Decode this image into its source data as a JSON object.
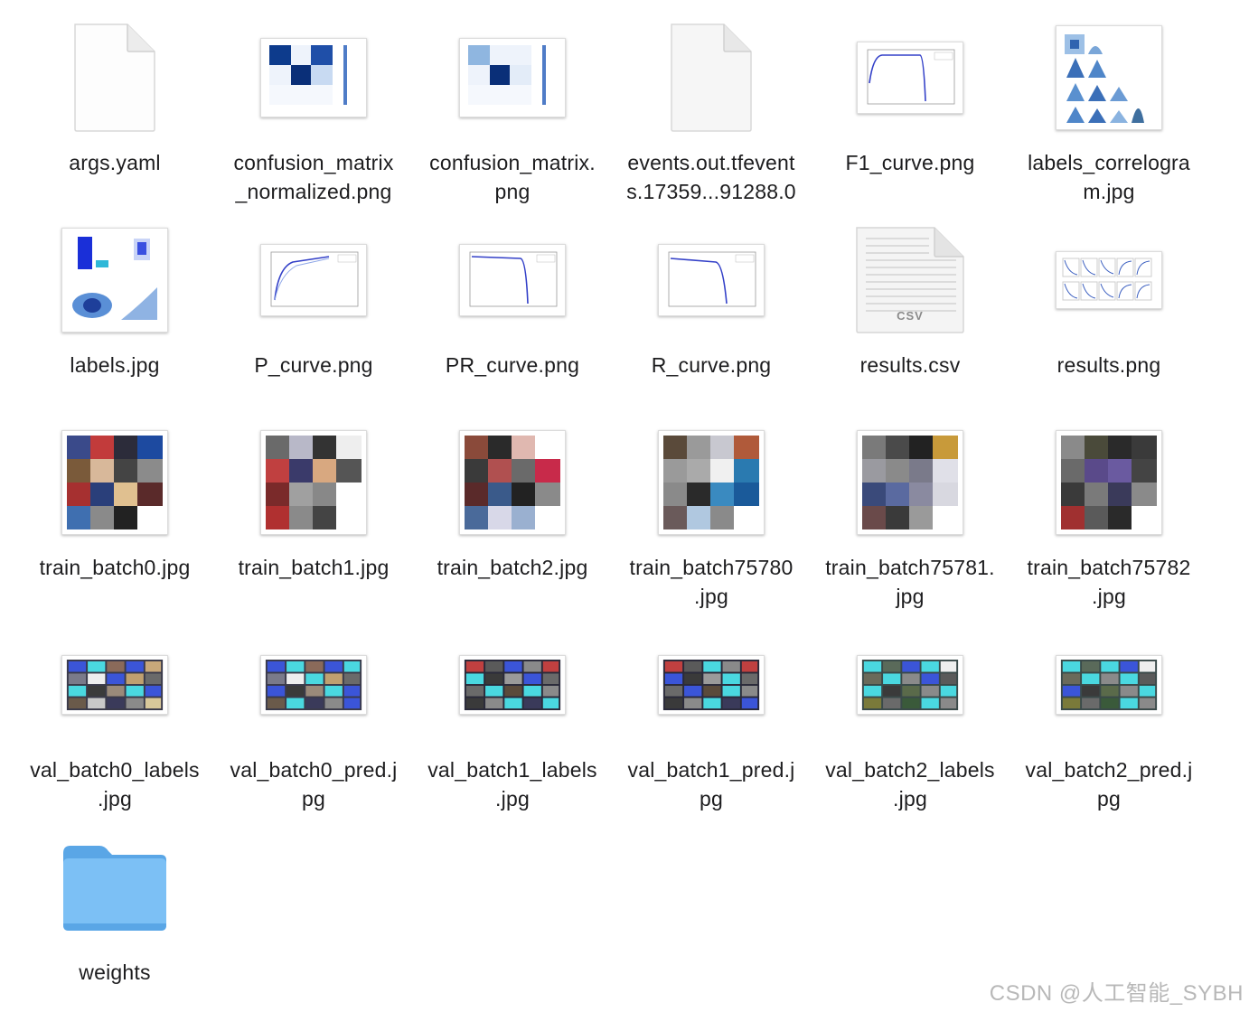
{
  "files": [
    {
      "label": "args.yaml",
      "kind": "doc-icon"
    },
    {
      "label": "confusion_matrix\n_normalized.png",
      "kind": "confusion-matrix-thumbnail"
    },
    {
      "label": "confusion_matrix.\npng",
      "kind": "confusion-matrix-thumbnail"
    },
    {
      "label": "events.out.tfevent\ns.17359...91288.0",
      "kind": "doc-icon"
    },
    {
      "label": "F1_curve.png",
      "kind": "curve-thumbnail"
    },
    {
      "label": "labels_correlogra\nm.jpg",
      "kind": "correlogram-thumbnail"
    },
    {
      "label": "labels.jpg",
      "kind": "labels-thumbnail"
    },
    {
      "label": "P_curve.png",
      "kind": "curve-thumbnail"
    },
    {
      "label": "PR_curve.png",
      "kind": "curve-thumbnail"
    },
    {
      "label": "R_curve.png",
      "kind": "curve-thumbnail"
    },
    {
      "label": "results.csv",
      "kind": "csv-icon",
      "badge": "CSV"
    },
    {
      "label": "results.png",
      "kind": "results-thumbnail"
    },
    {
      "label": "train_batch0.jpg",
      "kind": "photo-grid-thumbnail"
    },
    {
      "label": "train_batch1.jpg",
      "kind": "photo-grid-thumbnail"
    },
    {
      "label": "train_batch2.jpg",
      "kind": "photo-grid-thumbnail"
    },
    {
      "label": "train_batch75780\n.jpg",
      "kind": "photo-grid-thumbnail"
    },
    {
      "label": "train_batch75781.\njpg",
      "kind": "photo-grid-thumbnail"
    },
    {
      "label": "train_batch75782\n.jpg",
      "kind": "photo-grid-thumbnail"
    },
    {
      "label": "val_batch0_labels\n.jpg",
      "kind": "photo-strip-thumbnail"
    },
    {
      "label": "val_batch0_pred.j\npg",
      "kind": "photo-strip-thumbnail"
    },
    {
      "label": "val_batch1_labels\n.jpg",
      "kind": "photo-strip-thumbnail"
    },
    {
      "label": "val_batch1_pred.j\npg",
      "kind": "photo-strip-thumbnail"
    },
    {
      "label": "val_batch2_labels\n.jpg",
      "kind": "photo-strip-thumbnail"
    },
    {
      "label": "val_batch2_pred.j\npg",
      "kind": "photo-strip-thumbnail"
    },
    {
      "label": "weights",
      "kind": "folder-icon"
    }
  ],
  "watermark": "CSDN @人工智能_SYBH",
  "colors": {
    "folder": "#7cc0f5",
    "folder_dark": "#5aa6e6",
    "accent_blue": "#1f3f9f"
  }
}
